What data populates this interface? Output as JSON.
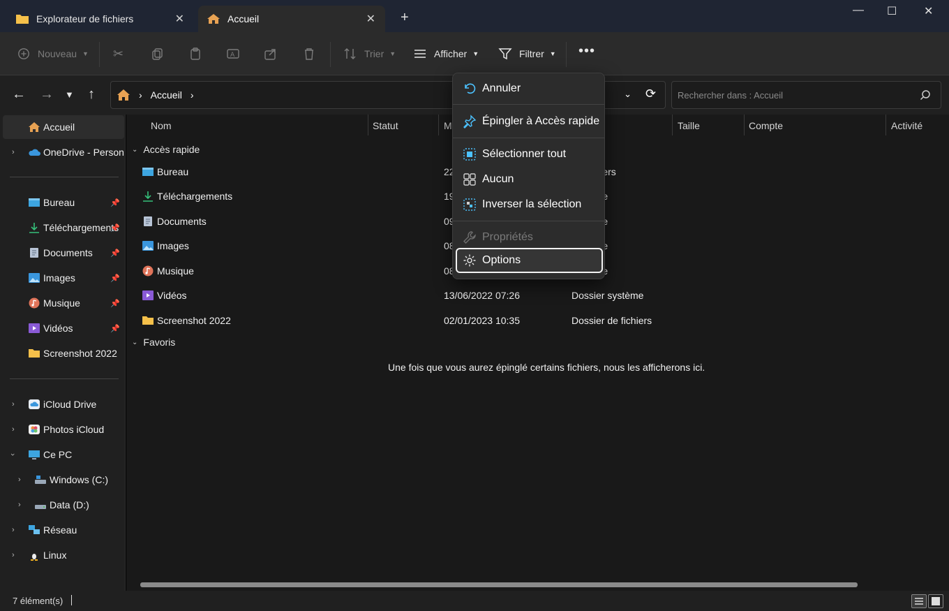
{
  "tabs": [
    {
      "label": "Explorateur de fichiers",
      "icon": "folder-icon"
    },
    {
      "label": "Accueil",
      "icon": "home-icon"
    }
  ],
  "toolbar": {
    "new_label": "Nouveau",
    "sort_label": "Trier",
    "view_label": "Afficher",
    "filter_label": "Filtrer"
  },
  "address": {
    "crumb": "Accueil",
    "search_placeholder": "Rechercher dans : Accueil"
  },
  "sidebar": {
    "items": [
      {
        "label": "Accueil",
        "icon": "home-icon"
      },
      {
        "label": "OneDrive - Persona",
        "icon": "onedrive-icon"
      },
      {
        "label": "Bureau",
        "icon": "desktop-folder-icon"
      },
      {
        "label": "Téléchargements",
        "icon": "download-icon"
      },
      {
        "label": "Documents",
        "icon": "documents-icon"
      },
      {
        "label": "Images",
        "icon": "pictures-icon"
      },
      {
        "label": "Musique",
        "icon": "music-icon"
      },
      {
        "label": "Vidéos",
        "icon": "videos-icon"
      },
      {
        "label": "Screenshot 2022",
        "icon": "folder-icon"
      },
      {
        "label": "iCloud Drive",
        "icon": "icloud-icon"
      },
      {
        "label": "Photos iCloud",
        "icon": "photos-icon"
      },
      {
        "label": "Ce PC",
        "icon": "pc-icon"
      },
      {
        "label": "Windows (C:)",
        "icon": "drive-icon"
      },
      {
        "label": "Data (D:)",
        "icon": "drive-icon"
      },
      {
        "label": "Réseau",
        "icon": "network-icon"
      },
      {
        "label": "Linux",
        "icon": "linux-icon"
      }
    ]
  },
  "columns": {
    "name": "Nom",
    "status": "Statut",
    "modified": "M",
    "size": "Taille",
    "account": "Compte",
    "activity": "Activité"
  },
  "groups": {
    "quick_access": "Accès rapide",
    "favorites": "Favoris"
  },
  "rows": [
    {
      "name": "Bureau",
      "date": "22",
      "type": "de fichiers"
    },
    {
      "name": "Téléchargements",
      "date": "19",
      "type": "système"
    },
    {
      "name": "Documents",
      "date": "09",
      "type": "système"
    },
    {
      "name": "Images",
      "date": "08",
      "type": "système"
    },
    {
      "name": "Musique",
      "date": "08",
      "type": "système"
    },
    {
      "name": "Vidéos",
      "date": "13/06/2022 07:26",
      "type": "Dossier système"
    },
    {
      "name": "Screenshot 2022",
      "date": "02/01/2023 10:35",
      "type": "Dossier de fichiers"
    }
  ],
  "empty_message": "Une fois que vous aurez épinglé certains fichiers, nous les afficherons ici.",
  "menu": {
    "undo": "Annuler",
    "pin": "Épingler à Accès rapide",
    "select_all": "Sélectionner tout",
    "select_none": "Aucun",
    "invert": "Inverser la sélection",
    "properties": "Propriétés",
    "options": "Options"
  },
  "status": {
    "count": "7 élément(s)"
  },
  "colors": {
    "accent": "#4cc2ff",
    "folder": "#f5c04a",
    "background": "#191919"
  }
}
